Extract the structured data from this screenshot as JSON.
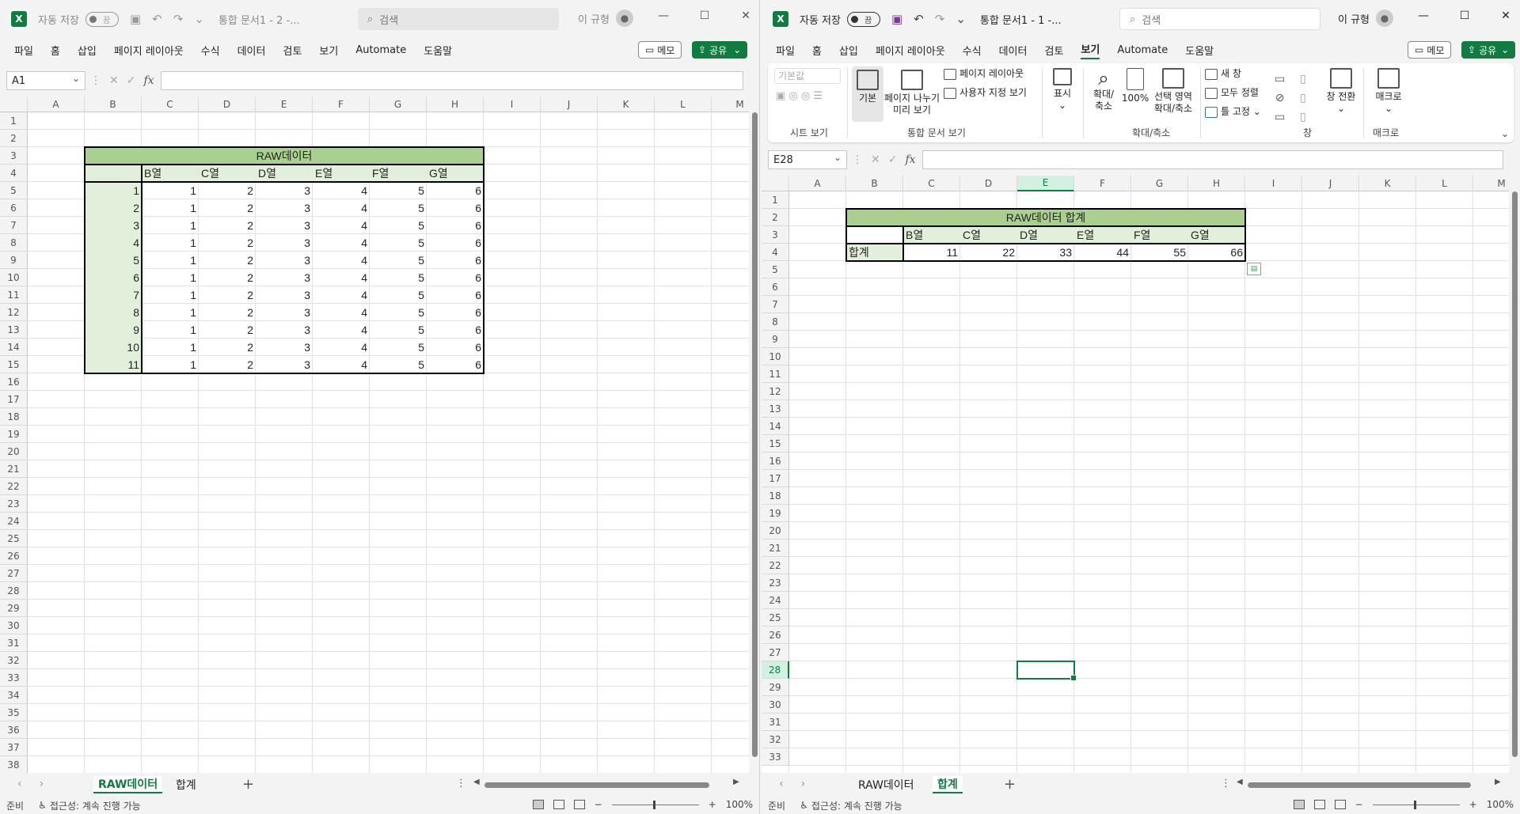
{
  "left": {
    "autosave_label": "자동 저장",
    "autosave_state": "끔",
    "doc_title": "통합 문서1 - 2 -...",
    "search_placeholder": "검색",
    "user_name": "이 규형",
    "menu": [
      "파일",
      "홈",
      "삽입",
      "페이지 레이아웃",
      "수식",
      "데이터",
      "검토",
      "보기",
      "Automate",
      "도움말"
    ],
    "memo_label": "메모",
    "share_label": "공유",
    "namebox": "A1",
    "columns": [
      "A",
      "B",
      "C",
      "D",
      "E",
      "F",
      "G",
      "H",
      "I",
      "J",
      "K",
      "L",
      "M"
    ],
    "rows": [
      "1",
      "2",
      "3",
      "4",
      "5",
      "6",
      "7",
      "8",
      "9",
      "10",
      "11",
      "12",
      "13",
      "14",
      "15",
      "16",
      "17",
      "18",
      "19",
      "20",
      "21",
      "22",
      "23",
      "24",
      "25",
      "26",
      "27",
      "28",
      "29",
      "30",
      "31",
      "32",
      "33",
      "34",
      "35",
      "36",
      "37",
      "38"
    ],
    "table_title": "RAW데이터",
    "table_headers": [
      "B열",
      "C열",
      "D열",
      "E열",
      "F열",
      "G열"
    ],
    "table_index": [
      "1",
      "2",
      "3",
      "4",
      "5",
      "6",
      "7",
      "8",
      "9",
      "10",
      "11"
    ],
    "table_row_values": [
      "1",
      "2",
      "3",
      "4",
      "5",
      "6"
    ],
    "tabs": [
      "RAW데이터",
      "합계"
    ],
    "active_tab": 0,
    "status": "준비",
    "accessibility": "접근성: 계속 진행 가능",
    "zoom": "100%"
  },
  "right": {
    "autosave_label": "자동 저장",
    "autosave_state": "끔",
    "doc_title": "통합 문서1 - 1 -...",
    "search_placeholder": "검색",
    "user_name": "이 규형",
    "menu": [
      "파일",
      "홈",
      "삽입",
      "페이지 레이아웃",
      "수식",
      "데이터",
      "검토",
      "보기",
      "Automate",
      "도움말"
    ],
    "active_menu": "보기",
    "memo_label": "메모",
    "share_label": "공유",
    "ribbon": {
      "sheet_view_default": "기본값",
      "normal": "기본",
      "page_break": [
        "페이지 나누기",
        "미리 보기"
      ],
      "page_layout": "페이지 레이아웃",
      "custom_view": "사용자 지정 보기",
      "show": "표시",
      "zoom": [
        "확대/",
        "축소"
      ],
      "zoom100": "100%",
      "zoom_sel": [
        "선택 영역",
        "확대/축소"
      ],
      "new_window": "새 창",
      "arrange_all": "모두 정렬",
      "freeze": "틀 고정",
      "switch_window": "창 전환",
      "macro": "매크로",
      "groups": [
        "시트 보기",
        "통합 문서 보기",
        "확대/축소",
        "창",
        "매크로"
      ]
    },
    "namebox": "E28",
    "columns": [
      "A",
      "B",
      "C",
      "D",
      "E",
      "F",
      "G",
      "H",
      "I",
      "J",
      "K",
      "L",
      "M"
    ],
    "rows": [
      "1",
      "2",
      "3",
      "4",
      "5",
      "6",
      "7",
      "8",
      "9",
      "10",
      "11",
      "12",
      "13",
      "14",
      "15",
      "16",
      "17",
      "18",
      "19",
      "20",
      "21",
      "22",
      "23",
      "24",
      "25",
      "26",
      "27",
      "28",
      "29",
      "30",
      "31",
      "32",
      "33"
    ],
    "table_title": "RAW데이터 합계",
    "table_headers": [
      "B열",
      "C열",
      "D열",
      "E열",
      "F열",
      "G열"
    ],
    "sum_label": "합계",
    "sum_values": [
      "11",
      "22",
      "33",
      "44",
      "55",
      "66"
    ],
    "tabs": [
      "RAW데이터",
      "합계"
    ],
    "active_tab": 1,
    "status": "준비",
    "accessibility": "접근성: 계속 진행 가능",
    "zoom": "100%"
  },
  "colors": {
    "accent": "#107c41",
    "header_fill": "#a9d08e",
    "light_fill": "#e2efda"
  }
}
